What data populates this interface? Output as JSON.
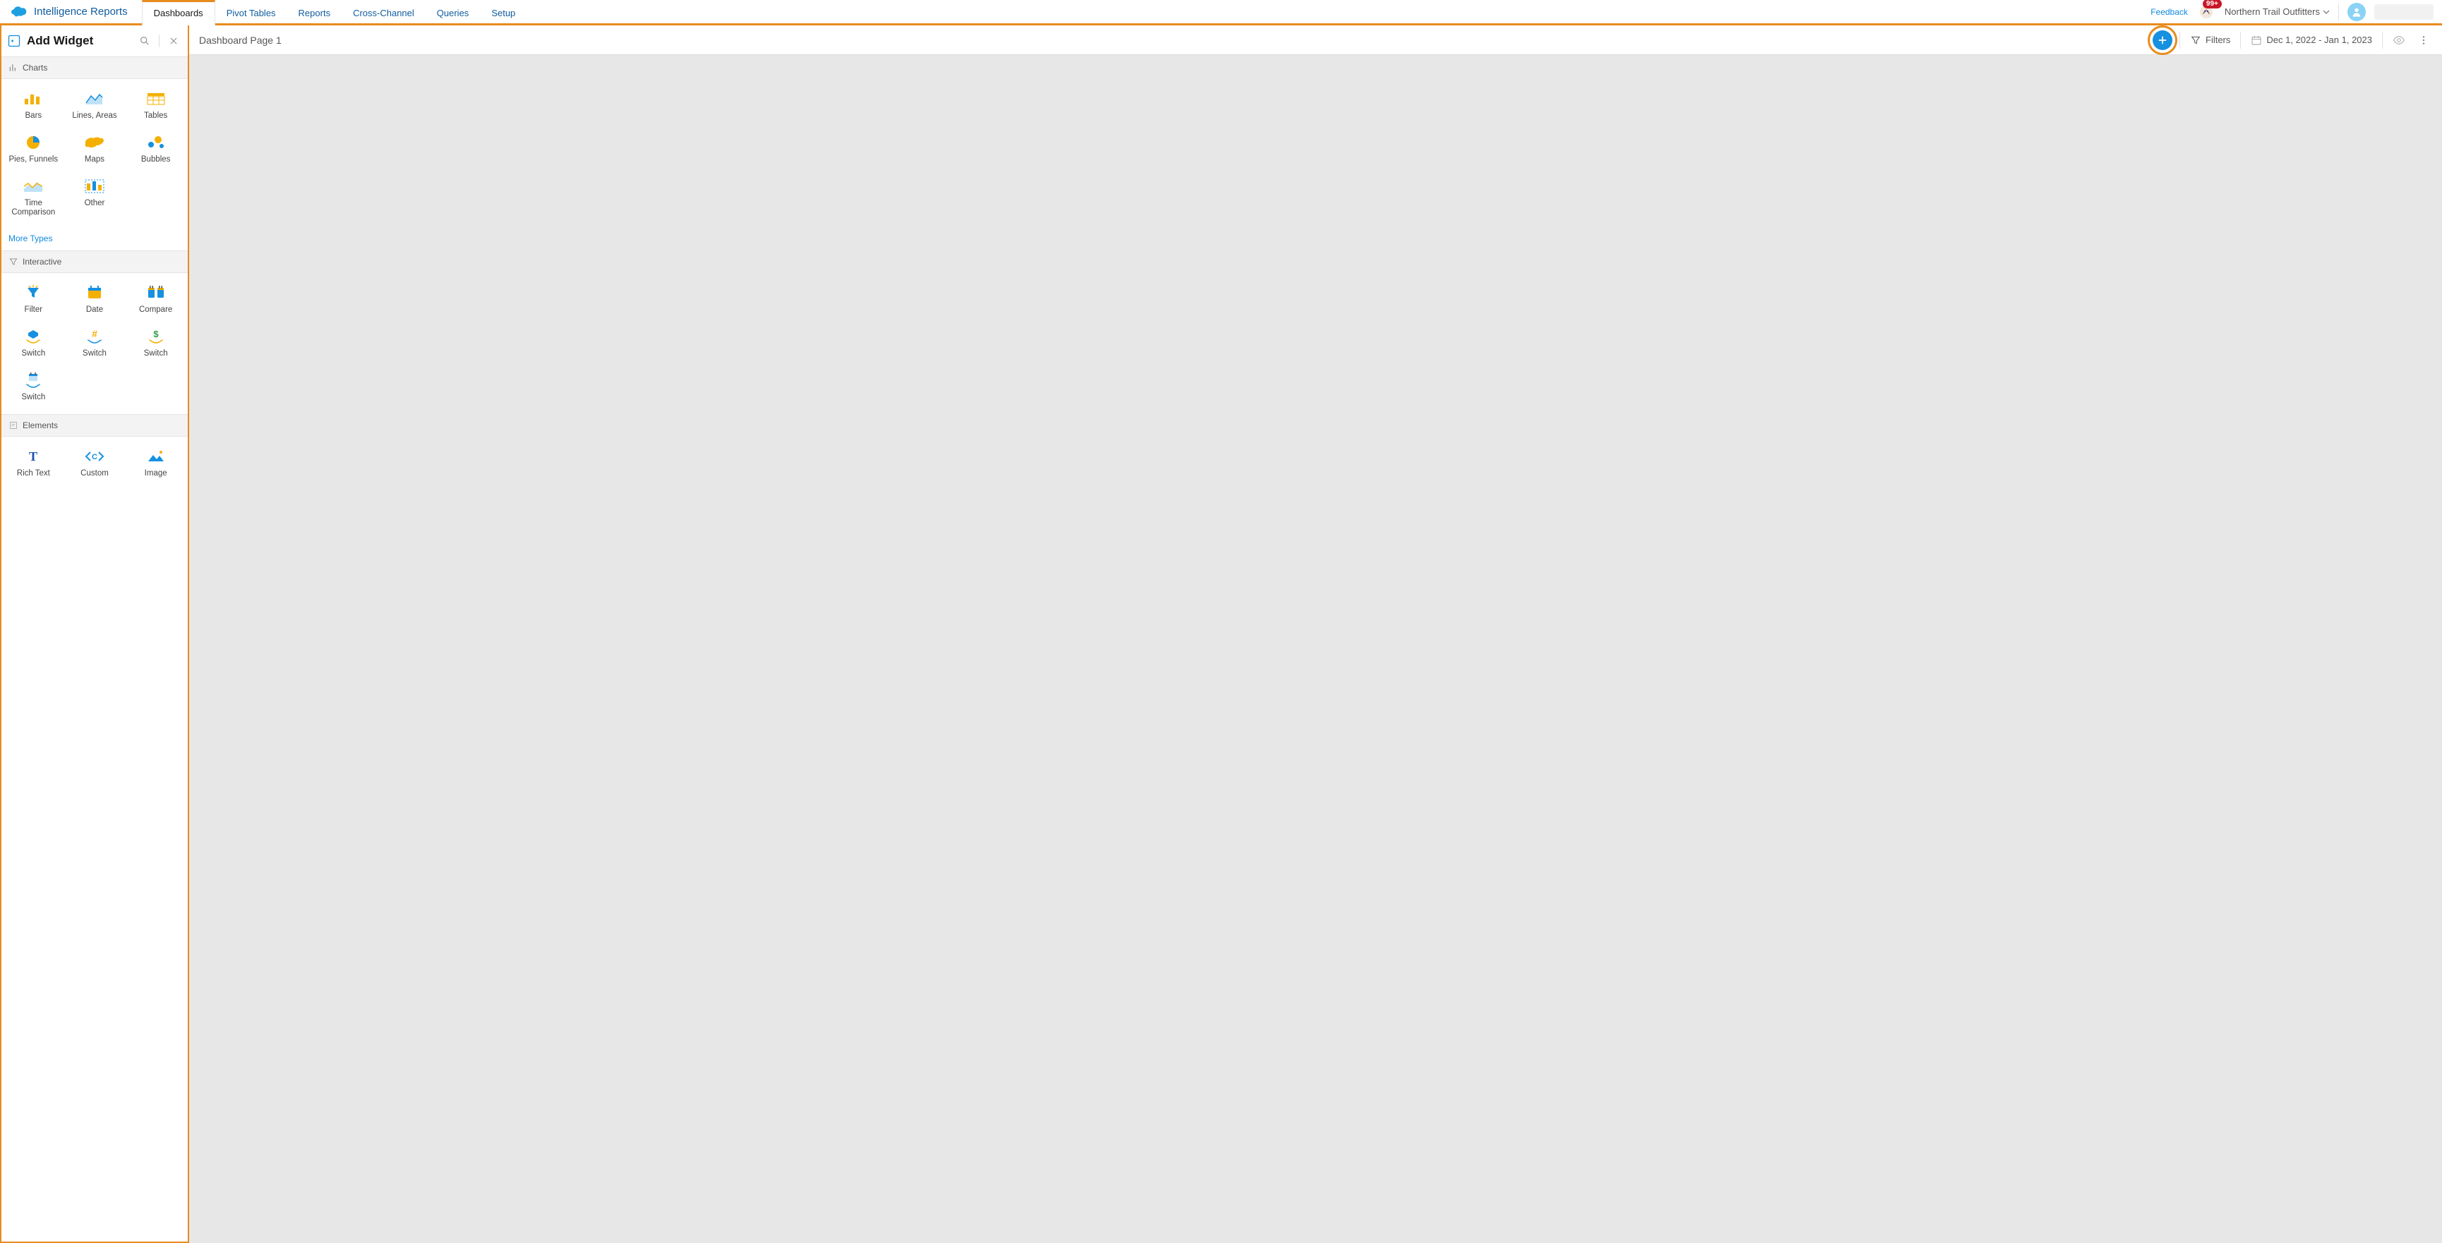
{
  "header": {
    "app_title": "Intelligence Reports",
    "tabs": [
      "Dashboards",
      "Pivot Tables",
      "Reports",
      "Cross-Channel",
      "Queries",
      "Setup"
    ],
    "active_tab_index": 0,
    "feedback_label": "Feedback",
    "notification_badge": "99+",
    "org_label": "Northern Trail Outfitters"
  },
  "sidebar": {
    "title": "Add Widget",
    "sections": {
      "charts": {
        "header": "Charts",
        "items": [
          "Bars",
          "Lines, Areas",
          "Tables",
          "Pies, Funnels",
          "Maps",
          "Bubbles",
          "Time Comparison",
          "Other"
        ],
        "more_types": "More Types"
      },
      "interactive": {
        "header": "Interactive",
        "items": [
          "Filter",
          "Date",
          "Compare",
          "Switch",
          "Switch",
          "Switch",
          "Switch"
        ]
      },
      "elements": {
        "header": "Elements",
        "items": [
          "Rich Text",
          "Custom",
          "Image"
        ]
      }
    }
  },
  "content": {
    "page_name": "Dashboard Page 1",
    "filters_label": "Filters",
    "date_range": "Dec 1, 2022 - Jan 1, 2023"
  },
  "colors": {
    "accent_orange": "#e88b1e",
    "link_blue": "#0f8ae0",
    "sf_blue": "#1690e0",
    "badge_red": "#c71628"
  }
}
